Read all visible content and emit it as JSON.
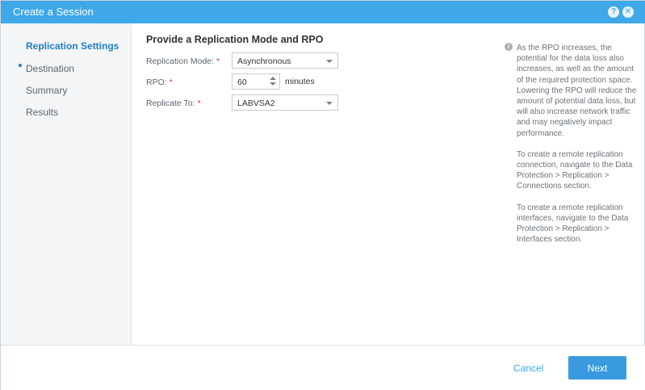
{
  "dialog": {
    "title": "Create a Session",
    "help_icon": "question-icon",
    "close_icon": "close-icon"
  },
  "sidebar": {
    "items": [
      {
        "label": "Replication Settings",
        "active": true
      },
      {
        "label": "Destination",
        "active": false
      },
      {
        "label": "Summary",
        "active": false
      },
      {
        "label": "Results",
        "active": false
      }
    ]
  },
  "form": {
    "heading": "Provide a Replication Mode and RPO",
    "required_marker": "*",
    "replication_mode": {
      "label": "Replication Mode:",
      "value": "Asynchronous"
    },
    "rpo": {
      "label": "RPO:",
      "value": "60",
      "unit": "minutes"
    },
    "replicate_to": {
      "label": "Replicate To:",
      "value": "LABVSA2"
    }
  },
  "info": {
    "icon": "info-icon",
    "paragraphs": [
      "As the RPO increases, the potential for the data loss also increases, as well as the amount of the required protection space. Lowering the RPO will reduce the amount of potential data loss, but will also increase network traffic and may negatively impact performance.",
      "To create a remote replication connection, navigate to the Data Protection > Replication > Connections section.",
      "To create a remote replication interfaces, navigate to the Data Protection > Replication > Interfaces section."
    ]
  },
  "footer": {
    "cancel_label": "Cancel",
    "next_label": "Next"
  },
  "colors": {
    "accent": "#3fa8e8",
    "primary_button": "#3a9ae0",
    "required": "#d9342b",
    "active_nav": "#1e7fc9"
  }
}
